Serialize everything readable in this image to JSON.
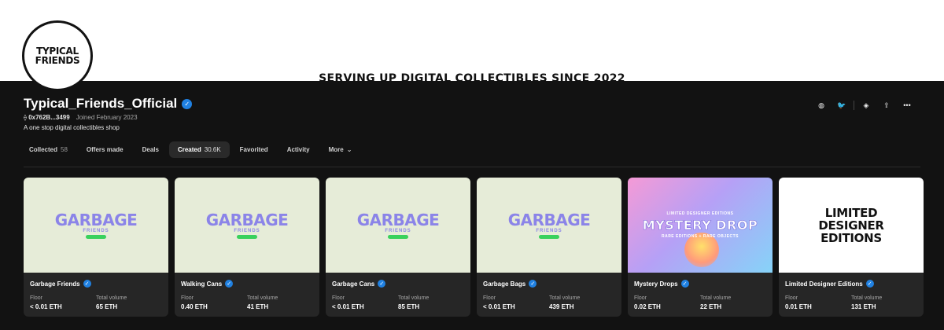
{
  "banner": {
    "text": "SERVING UP DIGITAL COLLECTIBLES SINCE 2022"
  },
  "avatar": {
    "line1": "TYPICAL",
    "line2": "FRIENDS"
  },
  "profile": {
    "name": "Typical_Friends_Official",
    "address": "0x762B...3499",
    "joined": "Joined February 2023",
    "bio": "A one stop digital collectibles shop"
  },
  "actions": [
    {
      "name": "website-icon",
      "glyph": "◍"
    },
    {
      "name": "twitter-icon",
      "glyph": "🐦"
    },
    {
      "name": "tag-icon",
      "glyph": "◈"
    },
    {
      "name": "share-icon",
      "glyph": "⇪"
    },
    {
      "name": "more-icon",
      "glyph": "•••"
    }
  ],
  "tabs": [
    {
      "label": "Collected",
      "count": "58"
    },
    {
      "label": "Offers made",
      "count": ""
    },
    {
      "label": "Deals",
      "count": ""
    },
    {
      "label": "Created",
      "count": "30.6K",
      "active": true
    },
    {
      "label": "Favorited",
      "count": ""
    },
    {
      "label": "Activity",
      "count": ""
    },
    {
      "label": "More",
      "count": ""
    }
  ],
  "stat_labels": {
    "floor": "Floor",
    "volume": "Total volume"
  },
  "cards": [
    {
      "name": "Garbage Friends",
      "image": {
        "type": "garbage",
        "title": "GARBAGE",
        "subtitle": "FRIENDS"
      },
      "floor": "< 0.01 ETH",
      "volume": "65 ETH"
    },
    {
      "name": "Walking Cans",
      "image": {
        "type": "garbage",
        "title": "GARBAGE",
        "subtitle": "FRIENDS"
      },
      "floor": "0.40 ETH",
      "volume": "41 ETH"
    },
    {
      "name": "Garbage Cans",
      "image": {
        "type": "garbage",
        "title": "GARBAGE",
        "subtitle": "FRIENDS"
      },
      "floor": "< 0.01 ETH",
      "volume": "85 ETH"
    },
    {
      "name": "Garbage Bags",
      "image": {
        "type": "garbage",
        "title": "GARBAGE",
        "subtitle": "FRIENDS"
      },
      "floor": "< 0.01 ETH",
      "volume": "439 ETH"
    },
    {
      "name": "Mystery Drops",
      "image": {
        "type": "mystery",
        "top": "LIMITED DESIGNER EDITIONS",
        "title": "MYSTERY DROP",
        "bottom": "RARE EDITIONS + RARE OBJECTS"
      },
      "floor": "0.02 ETH",
      "volume": "22 ETH"
    },
    {
      "name": "Limited Designer Editions",
      "image": {
        "type": "limited",
        "l1": "LIMITED",
        "l2": "DESIGNER",
        "l3": "EDITIONS"
      },
      "floor": "0.01 ETH",
      "volume": "131 ETH"
    }
  ],
  "colors": {
    "verified": "#2081e2",
    "garbage_bg": "#e6ecd8",
    "garbage_text": "#8b84e8",
    "pill": "#39d15c"
  }
}
